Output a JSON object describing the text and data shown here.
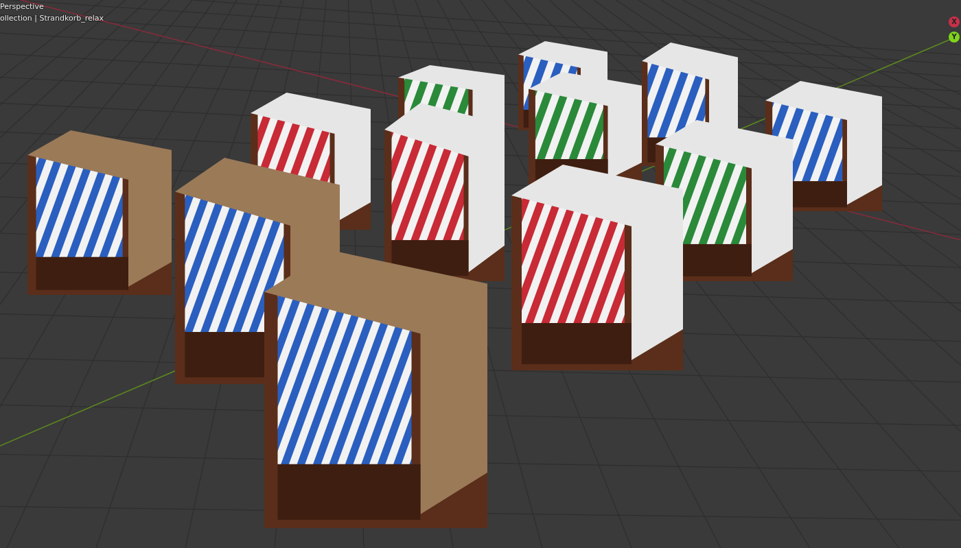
{
  "viewport": {
    "view_name": "Perspective",
    "collection_path": "ollection | Strandkorb_relax"
  },
  "gizmo": {
    "axes": [
      {
        "label": "X",
        "color": "#c8304a"
      },
      {
        "label": "Y",
        "color": "#7fd41c"
      }
    ]
  }
}
